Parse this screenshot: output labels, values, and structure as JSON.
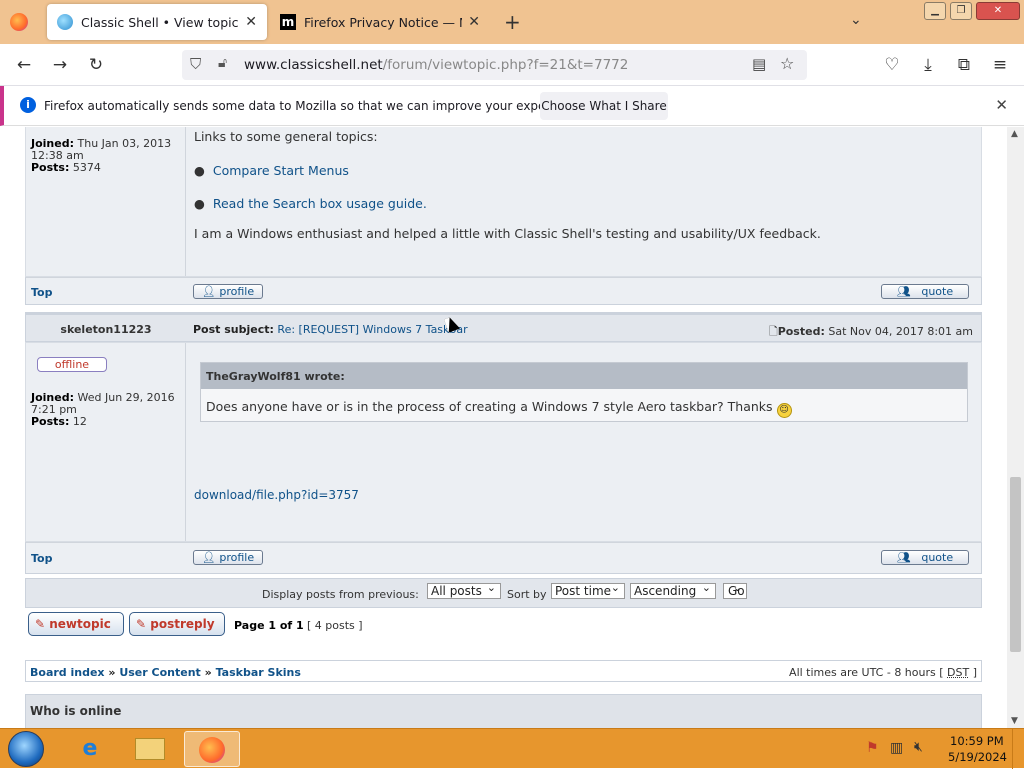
{
  "browser": {
    "tabs": [
      {
        "title": "Classic Shell • View topic - [REQ",
        "active": true
      },
      {
        "title": "Firefox Privacy Notice — Mozill",
        "active": false
      }
    ],
    "new_tab_icon": "+",
    "list_tabs_icon": "chevron-down",
    "url_domain": "www.classicshell.net",
    "url_path": "/forum/viewtopic.php?f=21&t=7772",
    "window_controls": [
      "minimize",
      "restore",
      "close"
    ]
  },
  "notification": {
    "message": "Firefox automatically sends some data to Mozilla so that we can improve your experience.",
    "button": "Choose What I Share"
  },
  "post1": {
    "joined_label": "Joined:",
    "joined_value": "Thu Jan 03, 2013 12:38 am",
    "posts_label": "Posts:",
    "posts_value": "5374",
    "intro": "Links to some general topics:",
    "links": [
      "Compare Start Menus",
      "Read the Search box usage guide."
    ],
    "text": "I am a Windows enthusiast and helped a little with Classic Shell's testing and usability/UX feedback.",
    "top": "Top",
    "profile": "profile",
    "quote": "quote"
  },
  "post2": {
    "author": "skeleton11223",
    "status": "offline",
    "subject_label": "Post subject:",
    "subject": "Re: [REQUEST] Windows 7 Taskbar",
    "posted_label": "Posted:",
    "posted": "Sat Nov 04, 2017 8:01 am",
    "joined_label": "Joined:",
    "joined_value": "Wed Jun 29, 2016 7:21 pm",
    "posts_label": "Posts:",
    "posts_value": "12",
    "quote_author": "TheGrayWolf81 wrote:",
    "quote_text": "Does anyone have or is in the process of creating a Windows 7 style Aero taskbar? Thanks",
    "download_link": "download/file.php?id=3757",
    "top": "Top",
    "profile": "profile",
    "quote": "quote"
  },
  "display_bar": {
    "label": "Display posts from previous:",
    "filter": "All posts",
    "sort_label": "Sort by",
    "sort": "Post time",
    "order": "Ascending",
    "go": "Go"
  },
  "pagination": {
    "new_topic": "newtopic",
    "post_reply": "postreply",
    "page": "Page 1 of 1",
    "posts": "[ 4 posts ]"
  },
  "breadcrumb": {
    "items": [
      "Board index",
      "User Content",
      "Taskbar Skins"
    ],
    "sep": "»",
    "tz": "All times are UTC - 8 hours [",
    "dst": "DST",
    "tz_end": "]"
  },
  "who_online": "Who is online",
  "taskbar": {
    "time": "10:59 PM",
    "date": "5/19/2024",
    "apps": [
      "start-orb",
      "internet-explorer",
      "file-explorer",
      "firefox"
    ]
  }
}
